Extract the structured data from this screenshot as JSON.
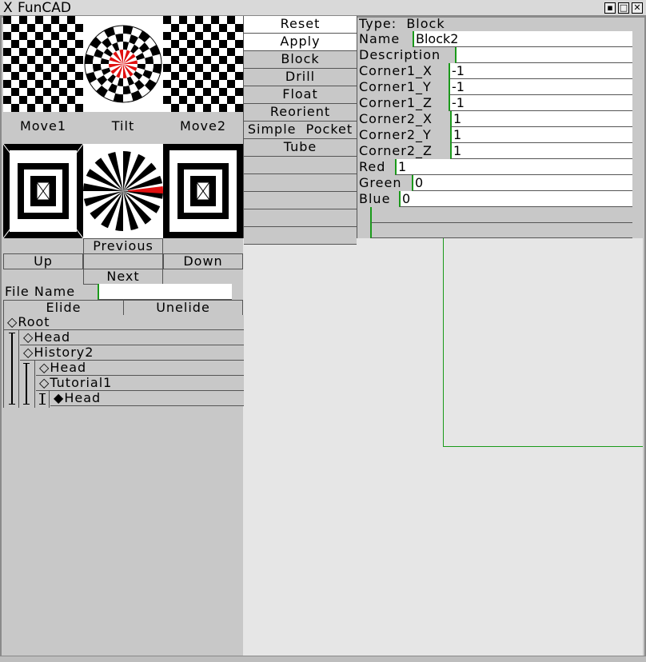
{
  "window": {
    "title": "FunCAD"
  },
  "view_labels": {
    "move1": "Move1",
    "tilt": "Tilt",
    "move2": "Move2"
  },
  "nav": {
    "previous": "Previous",
    "up": "Up",
    "down": "Down",
    "next": "Next"
  },
  "file": {
    "label": "File  Name",
    "value": ""
  },
  "elide": {
    "elide": "Elide",
    "unelide": "Unelide"
  },
  "tree": {
    "items": [
      {
        "label": "Root",
        "marker": "◇"
      },
      {
        "label": "Head",
        "marker": "◇"
      },
      {
        "label": "History2",
        "marker": "◇"
      },
      {
        "label": "Head",
        "marker": "◇"
      },
      {
        "label": "Tutorial1",
        "marker": "◇"
      },
      {
        "label": "Head",
        "marker": "◆"
      }
    ]
  },
  "commands": [
    "Reset",
    "Apply",
    "Block",
    "Drill",
    "Float",
    "Reorient",
    "Simple  Pocket",
    "Tube"
  ],
  "properties": {
    "type_label": "Type:",
    "type_value": "Block",
    "fields": [
      {
        "label": "Name",
        "value": "Block2"
      },
      {
        "label": "Description",
        "value": ""
      },
      {
        "label": "Corner1_X",
        "value": "-1"
      },
      {
        "label": "Corner1_Y",
        "value": "-1"
      },
      {
        "label": "Corner1_Z",
        "value": "-1"
      },
      {
        "label": "Corner2_X",
        "value": "1"
      },
      {
        "label": "Corner2_Y",
        "value": "1"
      },
      {
        "label": "Corner2_Z",
        "value": "1"
      },
      {
        "label": "Red",
        "value": "1"
      },
      {
        "label": "Green",
        "value": "0"
      },
      {
        "label": "Blue",
        "value": "0"
      }
    ]
  },
  "colors": {
    "accent_green": "#1a9a1a",
    "highlight_red": "#e01010"
  }
}
